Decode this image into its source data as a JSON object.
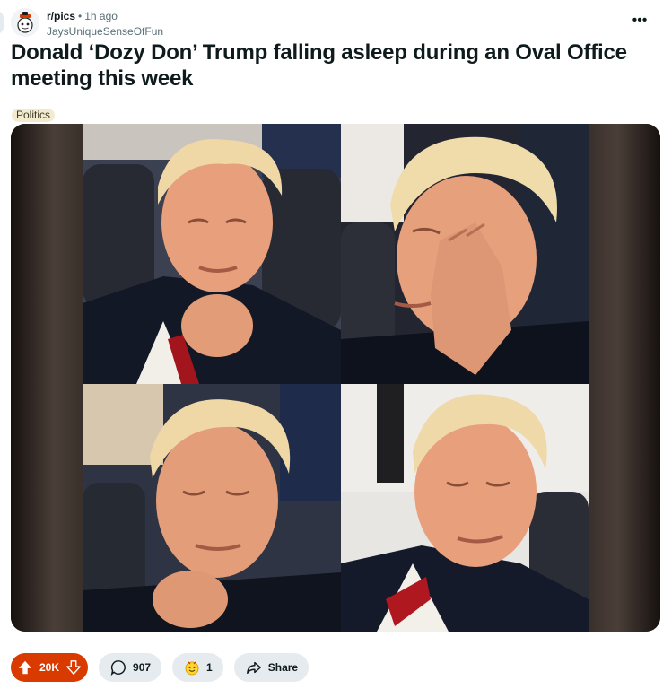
{
  "post": {
    "subreddit": "r/pics",
    "separator": "•",
    "age": "1h ago",
    "author": "JaysUniqueSenseOfFun",
    "overflow_label": "•••",
    "title": "Donald ‘Dozy Don’ Trump falling asleep during an Oval Office meeting this week",
    "flair": "Politics",
    "flair_color": "#f4ebcf"
  },
  "actions": {
    "votes": "20K",
    "comments": "907",
    "awards": "1",
    "share": "Share",
    "vote_color": "#d93a00"
  },
  "icons": [
    "reddit-avatar-icon",
    "overflow-menu-icon",
    "upvote-icon",
    "downvote-icon",
    "comment-icon",
    "award-icon",
    "share-icon"
  ]
}
